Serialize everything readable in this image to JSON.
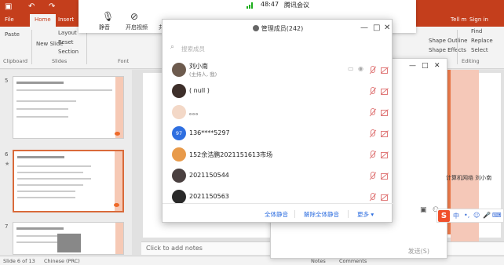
{
  "ppt": {
    "tabs": [
      "File",
      "Home",
      "Insert"
    ],
    "active_tab": "Home",
    "right_tabs": [
      "Tell m",
      "Sign in",
      "Share"
    ],
    "ribbon": {
      "clipboard_label": "Clipboard",
      "slides_label": "Slides",
      "font_label": "Font",
      "editing_label": "Editing",
      "paste": "Paste",
      "new_slide": "New\nSlide",
      "layout": "Layout",
      "reset": "Reset",
      "section": "Section",
      "shape_outline": "Shape Outline",
      "shape_effects": "Shape Effects",
      "find": "Find",
      "replace": "Replace",
      "select": "Select"
    },
    "slide_numbers": [
      "5",
      "6",
      "7"
    ],
    "notes_placeholder": "Click to add notes",
    "status": {
      "slide_info": "Slide 6 of 13",
      "language": "Chinese (PRC)",
      "notes": "Notes",
      "comments": "Comments"
    }
  },
  "meeting_bar": {
    "time": "48:47",
    "title": "腾讯会议",
    "mute_label": "静音",
    "video_label": "开启视频",
    "share_label": "共"
  },
  "panel": {
    "title": "管理成员(242)",
    "search_placeholder": "搜索成员",
    "members": [
      {
        "name": "刘小南",
        "sub": "(主持人, 我)",
        "avatar": "",
        "color": "#6d5b4e"
      },
      {
        "name": "( null )",
        "sub": "",
        "avatar": "",
        "color": "#3d2f2a"
      },
      {
        "name": "。。。",
        "sub": "",
        "avatar": "",
        "color": "#f3d8c7"
      },
      {
        "name": "136****5297",
        "sub": "",
        "avatar": "97",
        "color": "#2f6fe0"
      },
      {
        "name": "152余浩鹏2021151613市场",
        "sub": "",
        "avatar": "",
        "color": "#e89a4a"
      },
      {
        "name": "2021150544",
        "sub": "",
        "avatar": "",
        "color": "#4a4040"
      },
      {
        "name": "2021150563",
        "sub": "",
        "avatar": "",
        "color": "#2a2a2a"
      }
    ],
    "footer": {
      "mute_all": "全体静音",
      "unmute_all": "解除全体静音",
      "more": "更多"
    }
  },
  "chat": {
    "send_label": "发送(S)",
    "right_text": "计算机网络 刘小南"
  },
  "ime": {
    "logo": "S",
    "items": [
      "中",
      "•,",
      "☺",
      "🎤",
      "⌨"
    ]
  },
  "colors": {
    "ppt_red": "#c43e1c",
    "accent_blue": "#2f6fe0",
    "muted_red": "#e07a7a"
  }
}
